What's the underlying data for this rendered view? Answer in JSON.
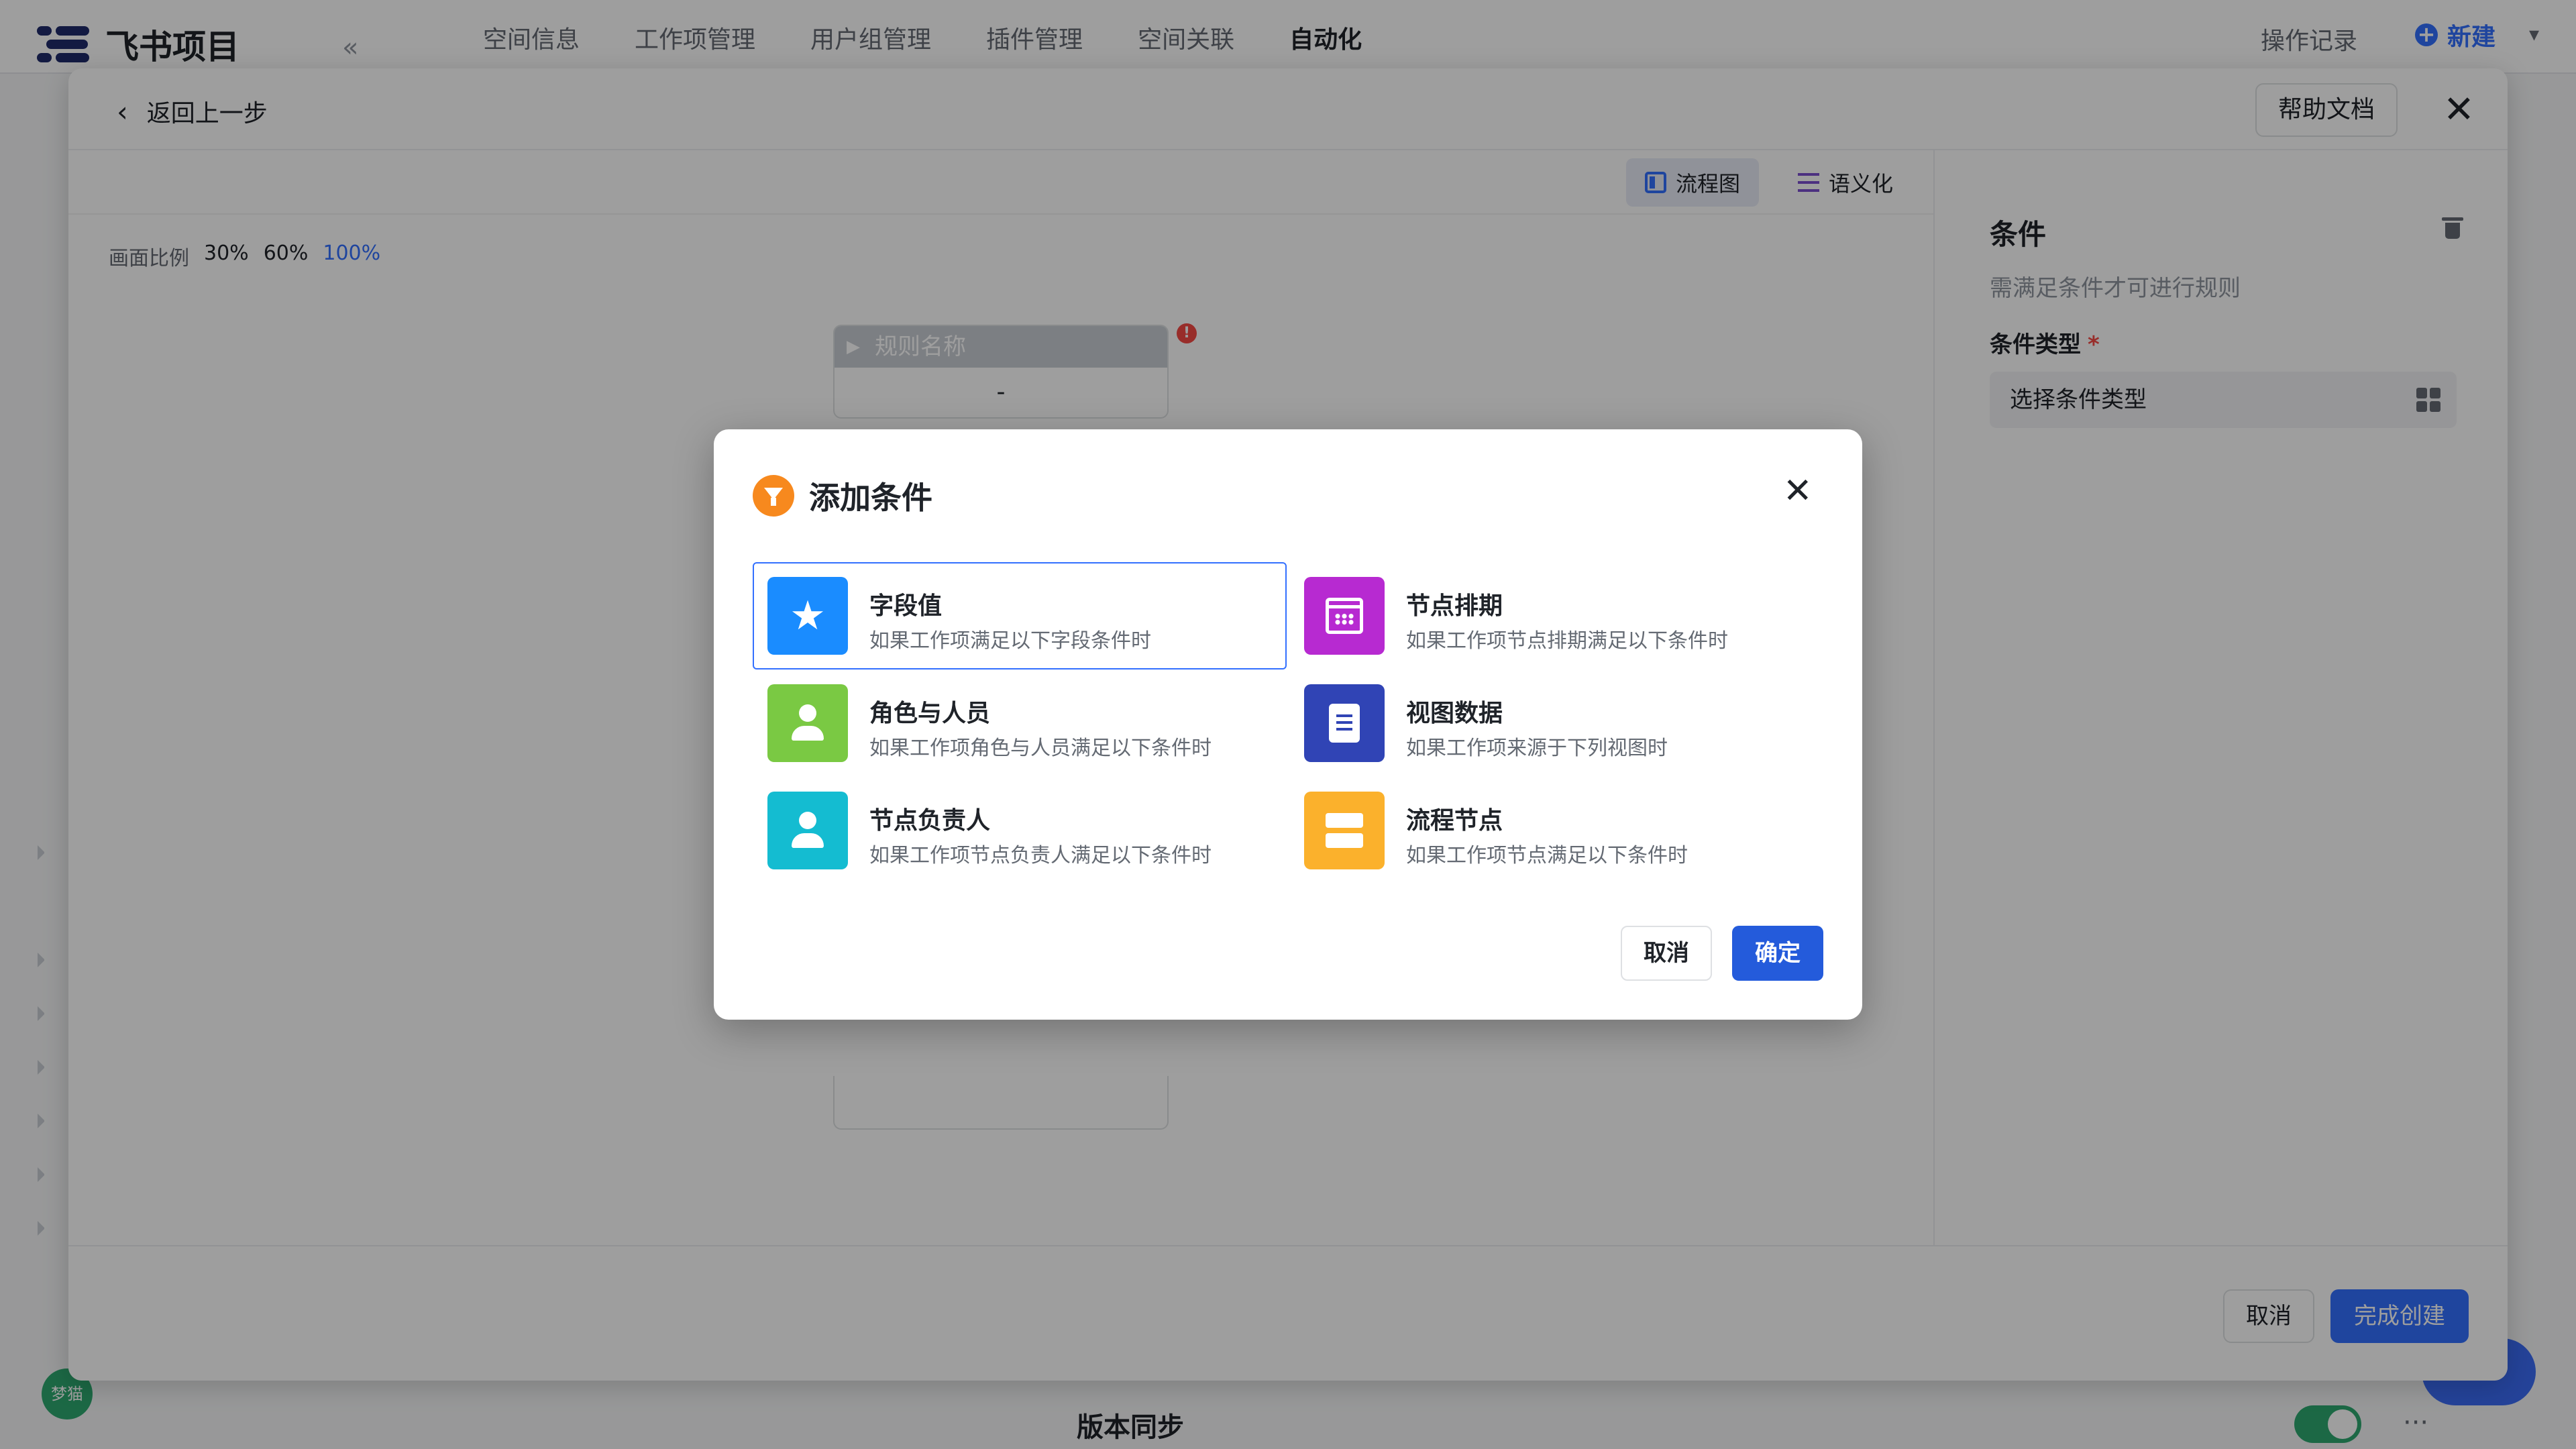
{
  "app": {
    "brand_name": "飞书项目",
    "nav_tabs": [
      "空间信息",
      "工作项管理",
      "用户组管理",
      "插件管理",
      "空间关联",
      "自动化"
    ],
    "active_tab": "自动化",
    "op_log_label": "操作记录",
    "new_label": "新建",
    "avatar_text": "梦猫",
    "bottom_section_title": "版本同步"
  },
  "editor": {
    "back_label": "返回上一步",
    "help_label": "帮助文档",
    "view_flow_label": "流程图",
    "view_semantic_label": "语义化",
    "zoom_label": "画面比例",
    "zoom_options": [
      "30%",
      "60%",
      "100%"
    ],
    "active_zoom": "100%",
    "rule_node_title": "规则名称",
    "rule_node_value": "-",
    "error_mark": "!",
    "add_label": "+",
    "footer_cancel": "取消",
    "footer_create": "完成创建"
  },
  "side_panel": {
    "title": "条件",
    "description": "需满足条件才可进行规则",
    "field_label": "条件类型",
    "required_mark": "*",
    "select_placeholder": "选择条件类型"
  },
  "modal": {
    "title": "添加条件",
    "cancel_label": "取消",
    "confirm_label": "确定",
    "options": [
      {
        "title": "字段值",
        "desc": "如果工作项满足以下字段条件时",
        "icon": "star-list-icon",
        "color": "#1a8cff",
        "selected": true
      },
      {
        "title": "节点排期",
        "desc": "如果工作项节点排期满足以下条件时",
        "icon": "calendar-icon",
        "color": "#b72ad1",
        "selected": false
      },
      {
        "title": "角色与人员",
        "desc": "如果工作项角色与人员满足以下条件时",
        "icon": "user-icon",
        "color": "#7ac943",
        "selected": false
      },
      {
        "title": "视图数据",
        "desc": "如果工作项来源于下列视图时",
        "icon": "document-icon",
        "color": "#3044b5",
        "selected": false
      },
      {
        "title": "节点负责人",
        "desc": "如果工作项节点负责人满足以下条件时",
        "icon": "user-icon",
        "color": "#14bcd1",
        "selected": false
      },
      {
        "title": "流程节点",
        "desc": "如果工作项节点满足以下条件时",
        "icon": "server-icon",
        "color": "#fbb12c",
        "selected": false
      }
    ]
  },
  "colors": {
    "accent": "#3370ff",
    "confirm": "#245bdb",
    "danger": "#f54a45",
    "modal_logo": "#f7891e"
  }
}
